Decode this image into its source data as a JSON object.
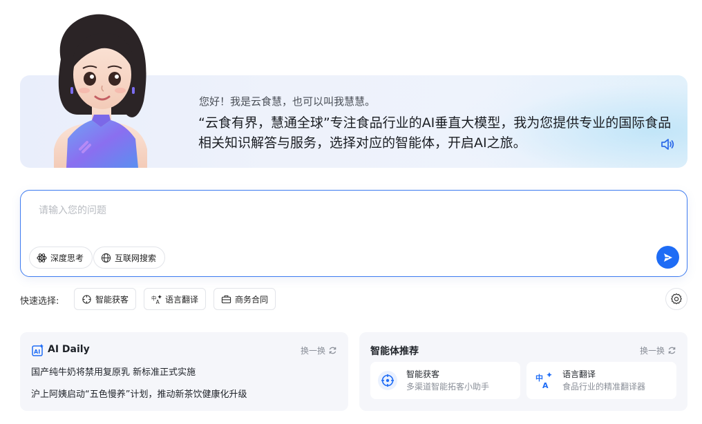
{
  "hero": {
    "greeting": "您好！我是云食慧，也可以叫我慧慧。",
    "intro": "“云食有界，慧通全球”专注食品行业的AI垂直大模型，我为您提供专业的国际食品相关知识解答与服务，选择对应的智能体，开启AI之旅。"
  },
  "input": {
    "placeholder": "请输入您的问题",
    "deep_think_label": "深度思考",
    "web_search_label": "互联网搜索"
  },
  "quick_select": {
    "label": "快速选择:",
    "items": [
      "智能获客",
      "语言翻译",
      "商务合同"
    ]
  },
  "ai_daily": {
    "title": "AI Daily",
    "refresh_label": "换一换",
    "news": [
      "国产纯牛奶将禁用复原乳 新标准正式实施",
      "沪上阿姨启动“五色慢养”计划，推动新茶饮健康化升级"
    ]
  },
  "agents": {
    "title": "智能体推荐",
    "refresh_label": "换一换",
    "items": [
      {
        "name": "智能获客",
        "desc": "多渠道智能拓客小助手"
      },
      {
        "name": "语言翻译",
        "desc": "食品行业的精准翻译器"
      }
    ]
  },
  "colors": {
    "accent": "#1e6cf5",
    "input_border": "#3d7bf0",
    "card_bg": "#f5f6fa",
    "hero_bg": "#eef2fb"
  },
  "icons": [
    "speaker-icon",
    "atom-icon",
    "globe-icon",
    "send-icon",
    "crosshair-icon",
    "translate-icon",
    "briefcase-icon",
    "gear-icon",
    "ai-daily-icon",
    "refresh-icon"
  ]
}
